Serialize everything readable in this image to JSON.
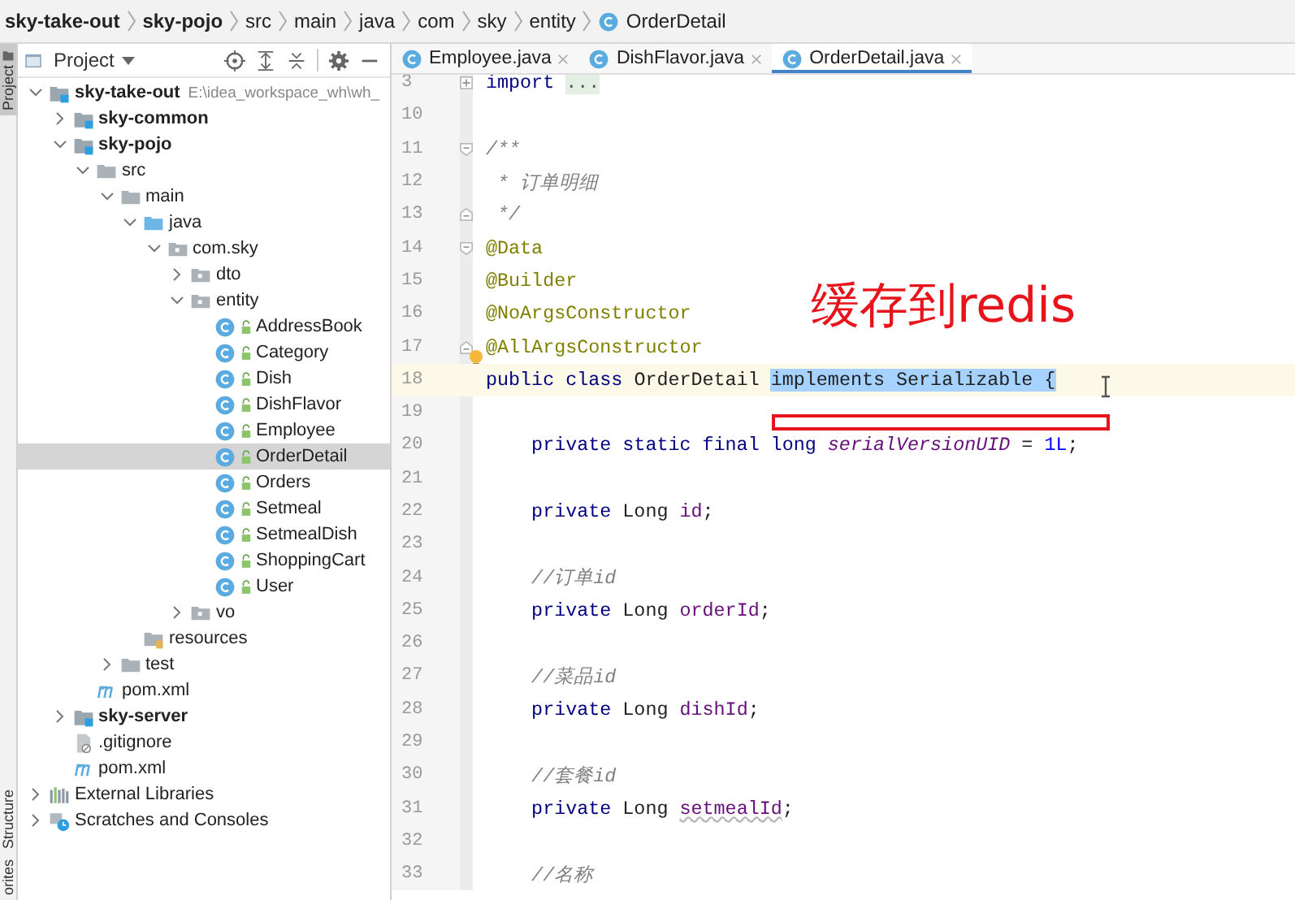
{
  "breadcrumbs": [
    {
      "kind": "module",
      "label": "sky-take-out"
    },
    {
      "kind": "module",
      "label": "sky-pojo"
    },
    {
      "kind": "folder",
      "label": "src"
    },
    {
      "kind": "folder",
      "label": "main"
    },
    {
      "kind": "folder",
      "label": "java"
    },
    {
      "kind": "folder",
      "label": "com"
    },
    {
      "kind": "folder",
      "label": "sky"
    },
    {
      "kind": "folder",
      "label": "entity"
    },
    {
      "kind": "class",
      "label": "OrderDetail"
    }
  ],
  "left_strip": [
    {
      "label": "Project",
      "selected": true
    },
    {
      "label": "Structure",
      "selected": false
    },
    {
      "label": "orites",
      "selected": false
    }
  ],
  "project": {
    "title": "Project",
    "tree": [
      {
        "kind": "module",
        "label": "sky-take-out",
        "bold": true,
        "hint": "E:\\idea_workspace_wh\\wh_",
        "expanded": true,
        "selected": false,
        "children": [
          {
            "kind": "module",
            "label": "sky-common",
            "bold": true,
            "expanded": false,
            "selected": false
          },
          {
            "kind": "module",
            "label": "sky-pojo",
            "bold": true,
            "expanded": true,
            "selected": false,
            "children": [
              {
                "kind": "folder",
                "label": "src",
                "bold": false,
                "expanded": true,
                "selected": false,
                "children": [
                  {
                    "kind": "folder",
                    "label": "main",
                    "bold": false,
                    "expanded": true,
                    "selected": false,
                    "children": [
                      {
                        "kind": "source-folder",
                        "label": "java",
                        "bold": false,
                        "expanded": true,
                        "selected": false,
                        "children": [
                          {
                            "kind": "package",
                            "label": "com.sky",
                            "bold": false,
                            "expanded": true,
                            "selected": false,
                            "children": [
                              {
                                "kind": "package",
                                "label": "dto",
                                "bold": false,
                                "expanded": false,
                                "selected": false
                              },
                              {
                                "kind": "package",
                                "label": "entity",
                                "bold": false,
                                "expanded": true,
                                "selected": false,
                                "children": [
                                  {
                                    "kind": "class",
                                    "label": "AddressBook",
                                    "bold": false,
                                    "selected": false
                                  },
                                  {
                                    "kind": "class",
                                    "label": "Category",
                                    "bold": false,
                                    "selected": false
                                  },
                                  {
                                    "kind": "class",
                                    "label": "Dish",
                                    "bold": false,
                                    "selected": false
                                  },
                                  {
                                    "kind": "class",
                                    "label": "DishFlavor",
                                    "bold": false,
                                    "selected": false
                                  },
                                  {
                                    "kind": "class",
                                    "label": "Employee",
                                    "bold": false,
                                    "selected": false
                                  },
                                  {
                                    "kind": "class",
                                    "label": "OrderDetail",
                                    "bold": false,
                                    "selected": true
                                  },
                                  {
                                    "kind": "class",
                                    "label": "Orders",
                                    "bold": false,
                                    "selected": false
                                  },
                                  {
                                    "kind": "class",
                                    "label": "Setmeal",
                                    "bold": false,
                                    "selected": false
                                  },
                                  {
                                    "kind": "class",
                                    "label": "SetmealDish",
                                    "bold": false,
                                    "selected": false
                                  },
                                  {
                                    "kind": "class",
                                    "label": "ShoppingCart",
                                    "bold": false,
                                    "selected": false
                                  },
                                  {
                                    "kind": "class",
                                    "label": "User",
                                    "bold": false,
                                    "selected": false
                                  }
                                ]
                              },
                              {
                                "kind": "package",
                                "label": "vo",
                                "bold": false,
                                "expanded": false,
                                "selected": false
                              }
                            ]
                          }
                        ]
                      },
                      {
                        "kind": "resources-folder",
                        "label": "resources",
                        "bold": false,
                        "selected": false
                      }
                    ]
                  },
                  {
                    "kind": "folder",
                    "label": "test",
                    "bold": false,
                    "expanded": false,
                    "selected": false
                  }
                ]
              },
              {
                "kind": "maven",
                "label": "pom.xml",
                "bold": false,
                "selected": false
              }
            ]
          },
          {
            "kind": "module",
            "label": "sky-server",
            "bold": true,
            "expanded": false,
            "selected": false
          },
          {
            "kind": "gitignore",
            "label": ".gitignore",
            "bold": false,
            "selected": false
          },
          {
            "kind": "maven",
            "label": "pom.xml",
            "bold": false,
            "selected": false
          }
        ]
      },
      {
        "kind": "libraries",
        "label": "External Libraries",
        "bold": false,
        "expanded": false,
        "selected": false
      },
      {
        "kind": "scratches",
        "label": "Scratches and Consoles",
        "bold": false,
        "expanded": false,
        "selected": false
      }
    ]
  },
  "tabs": [
    {
      "label": "Employee.java",
      "selected": false
    },
    {
      "label": "DishFlavor.java",
      "selected": false
    },
    {
      "label": "OrderDetail.java",
      "selected": true
    }
  ],
  "code": [
    {
      "number": "3",
      "fold": {
        "kind": "expand"
      },
      "tokens": [
        {
          "kind": "keyword",
          "text": "import "
        },
        {
          "kind": "folded",
          "text": "..."
        }
      ]
    },
    {
      "number": "10"
    },
    {
      "number": "11",
      "fold": {
        "kind": "start"
      },
      "tokens": [
        {
          "kind": "comment",
          "text": "/**"
        }
      ]
    },
    {
      "number": "12",
      "tokens": [
        {
          "kind": "comment",
          "text": " * 订单明细"
        }
      ]
    },
    {
      "number": "13",
      "fold": {
        "kind": "end"
      },
      "tokens": [
        {
          "kind": "comment",
          "text": " */"
        }
      ]
    },
    {
      "number": "14",
      "fold": {
        "kind": "start"
      },
      "tokens": [
        {
          "kind": "annotation",
          "text": "@Data"
        }
      ]
    },
    {
      "number": "15",
      "tokens": [
        {
          "kind": "annotation",
          "text": "@Builder"
        }
      ]
    },
    {
      "number": "16",
      "tokens": [
        {
          "kind": "annotation",
          "text": "@NoArgsConstructor"
        }
      ]
    },
    {
      "number": "17",
      "fold": {
        "kind": "end"
      },
      "bulb": true,
      "tokens": [
        {
          "kind": "annotation",
          "text": "@AllArgsConstructor"
        }
      ]
    },
    {
      "number": "18",
      "current": true,
      "tokens": [
        {
          "kind": "keyword",
          "text": "public class "
        },
        {
          "kind": "plain",
          "text": "OrderDetail "
        },
        {
          "kind": "selected",
          "text": "implements Serializable {"
        }
      ]
    },
    {
      "number": "19"
    },
    {
      "number": "20",
      "tokens": [
        {
          "kind": "keyword",
          "text": "    private static final long "
        },
        {
          "kind": "static-field",
          "text": "serialVersionUID"
        },
        {
          "kind": "plain",
          "text": " = "
        },
        {
          "kind": "number",
          "text": "1L"
        },
        {
          "kind": "plain",
          "text": ";"
        }
      ]
    },
    {
      "number": "21"
    },
    {
      "number": "22",
      "tokens": [
        {
          "kind": "keyword",
          "text": "    private "
        },
        {
          "kind": "plain",
          "text": "Long "
        },
        {
          "kind": "field",
          "text": "id"
        },
        {
          "kind": "plain",
          "text": ";"
        }
      ]
    },
    {
      "number": "23"
    },
    {
      "number": "24",
      "tokens": [
        {
          "kind": "comment",
          "text": "    //订单id"
        }
      ]
    },
    {
      "number": "25",
      "tokens": [
        {
          "kind": "keyword",
          "text": "    private "
        },
        {
          "kind": "plain",
          "text": "Long "
        },
        {
          "kind": "field",
          "text": "orderId"
        },
        {
          "kind": "plain",
          "text": ";"
        }
      ]
    },
    {
      "number": "26"
    },
    {
      "number": "27",
      "tokens": [
        {
          "kind": "comment",
          "text": "    //菜品id"
        }
      ]
    },
    {
      "number": "28",
      "tokens": [
        {
          "kind": "keyword",
          "text": "    private "
        },
        {
          "kind": "plain",
          "text": "Long "
        },
        {
          "kind": "field",
          "text": "dishId"
        },
        {
          "kind": "plain",
          "text": ";"
        }
      ]
    },
    {
      "number": "29"
    },
    {
      "number": "30",
      "tokens": [
        {
          "kind": "comment",
          "text": "    //套餐id"
        }
      ]
    },
    {
      "number": "31",
      "tokens": [
        {
          "kind": "keyword",
          "text": "    private "
        },
        {
          "kind": "plain",
          "text": "Long "
        },
        {
          "kind": "field-warning",
          "text": "setmealId"
        },
        {
          "kind": "plain",
          "text": ";"
        }
      ]
    },
    {
      "number": "32"
    },
    {
      "number": "33",
      "tokens": [
        {
          "kind": "comment",
          "text": "    //名称"
        }
      ]
    }
  ],
  "annotation": {
    "text": "缓存到redis"
  }
}
